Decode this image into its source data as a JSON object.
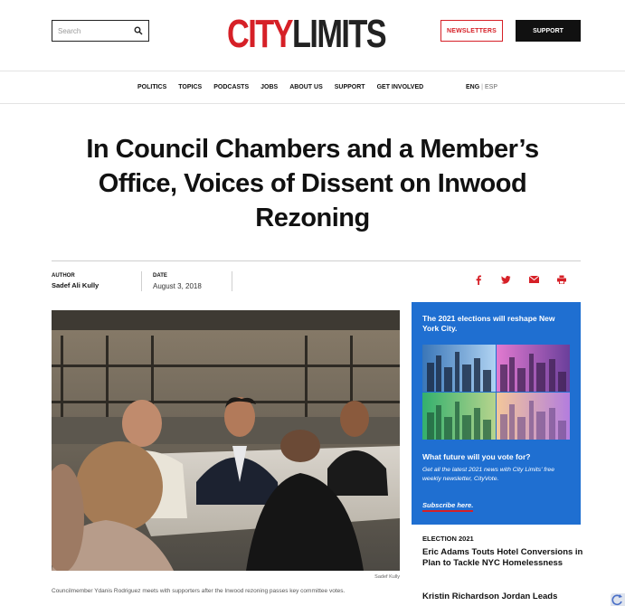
{
  "header": {
    "search_placeholder": "Search",
    "logo_city": "CITY",
    "logo_limits": "LIMITS",
    "newsletters_label": "NEWSLETTERS",
    "support_label": "SUPPORT"
  },
  "nav": {
    "items": [
      "POLITICS",
      "TOPICS",
      "PODCASTS",
      "JOBS",
      "ABOUT US",
      "SUPPORT",
      "GET INVOLVED"
    ],
    "lang_eng": "ENG",
    "lang_sep": "|",
    "lang_esp": "ESP"
  },
  "article": {
    "title": "In Council Chambers and a Member’s Office, Voices of Dissent on Inwood Rezoning",
    "author_label": "AUTHOR",
    "author_name": "Sadef Ali Kully",
    "date_label": "DATE",
    "date_value": "August 3, 2018",
    "photo_credit": "Sadef Kully",
    "caption": "Councilmember Ydanis Rodriguez meets with supporters after the Inwood rezoning passes key committee votes."
  },
  "share_icons": [
    "facebook-icon",
    "twitter-icon",
    "email-icon",
    "print-icon"
  ],
  "promo": {
    "headline": "The 2021 elections will reshape New York City.",
    "question": "What future will you vote for?",
    "body": "Get all the latest 2021 news with City Limits' free weekly newsletter, CityVote.",
    "link": "Subscribe here."
  },
  "sidebar": {
    "category": "ELECTION 2021",
    "headline_1": "Eric Adams Touts Hotel Conversions in Plan to Tackle NYC Homelessness",
    "headline_2": "Kristin Richardson Jordan Leads"
  },
  "colors": {
    "brand_red": "#d62027",
    "promo_blue": "#1f6fd1",
    "text_dark": "#111111"
  }
}
